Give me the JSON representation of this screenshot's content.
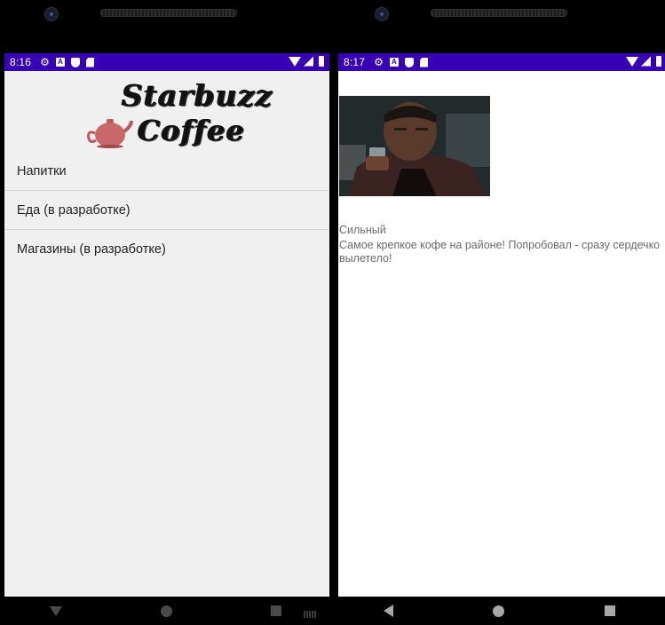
{
  "left_phone": {
    "status_bar": {
      "time": "8:16"
    },
    "logo": {
      "line1": "Starbuzz",
      "line2": "Coffee"
    },
    "menu": [
      {
        "label": "Напитки"
      },
      {
        "label": "Еда (в разработке)"
      },
      {
        "label": "Магазины (в разработке)"
      }
    ]
  },
  "right_phone": {
    "status_bar": {
      "time": "8:17"
    },
    "drink": {
      "name": "Сильный",
      "description": "Самое крепкое кофе на районе! Попробовал - сразу сердечко вылетело!"
    }
  },
  "icons": {
    "status_left": [
      "gear-icon",
      "a-icon",
      "shield-icon",
      "sd-card-icon"
    ],
    "status_right": [
      "wifi-icon",
      "signal-icon",
      "battery-icon"
    ],
    "nav": [
      "back-icon",
      "home-icon",
      "recents-icon"
    ]
  },
  "colors": {
    "status_bar": "#3700b3",
    "list_background": "#f0f0f0",
    "detail_background": "#ffffff",
    "teapot": "#c8686a"
  }
}
